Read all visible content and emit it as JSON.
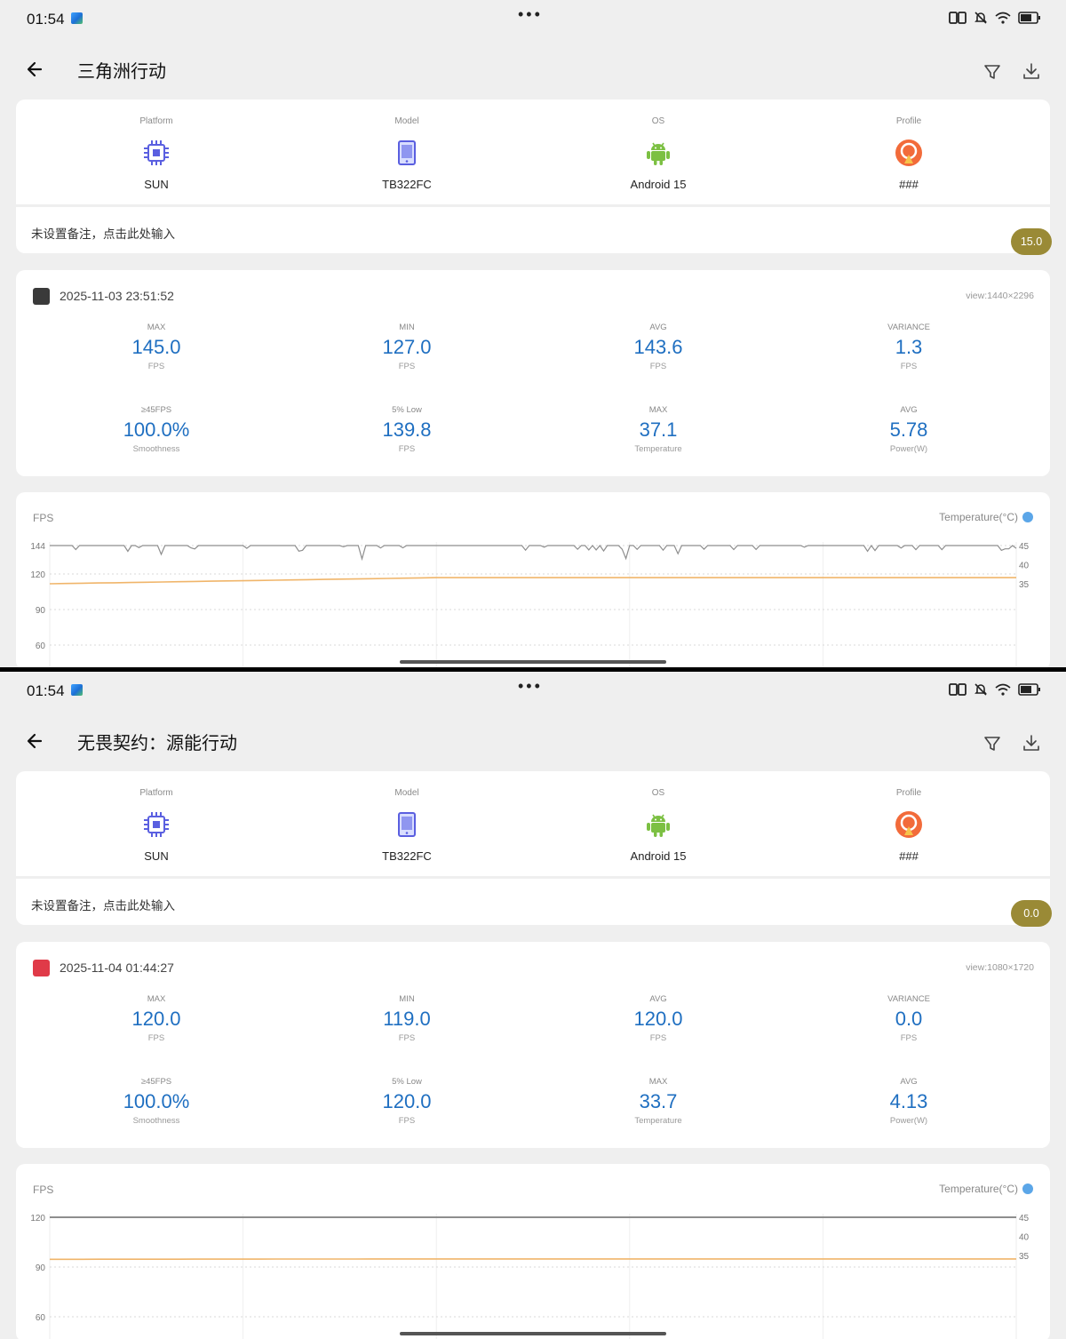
{
  "screens": [
    {
      "status": {
        "time": "01:54"
      },
      "header": {
        "title": "三角洲行动"
      },
      "device": [
        {
          "label": "Platform",
          "value": "SUN",
          "icon": "chip-icon"
        },
        {
          "label": "Model",
          "value": "TB322FC",
          "icon": "tablet-icon"
        },
        {
          "label": "OS",
          "value": "Android 15",
          "icon": "android-icon"
        },
        {
          "label": "Profile",
          "value": "###",
          "icon": "profile-icon"
        }
      ],
      "note": {
        "text": "未设置备注，点击此处输入",
        "score": "15.0"
      },
      "session": {
        "datetime": "2025-11-03 23:51:52",
        "view": "view:1440×2296",
        "metrics": [
          {
            "label": "MAX",
            "value": "145.0",
            "unit": "FPS"
          },
          {
            "label": "MIN",
            "value": "127.0",
            "unit": "FPS"
          },
          {
            "label": "AVG",
            "value": "143.6",
            "unit": "FPS"
          },
          {
            "label": "VARIANCE",
            "value": "1.3",
            "unit": "FPS"
          },
          {
            "label": "≥45FPS",
            "value": "100.0%",
            "unit": "Smoothness"
          },
          {
            "label": "5% Low",
            "value": "139.8",
            "unit": "FPS"
          },
          {
            "label": "MAX",
            "value": "37.1",
            "unit": "Temperature"
          },
          {
            "label": "AVG",
            "value": "5.78",
            "unit": "Power(W)"
          }
        ]
      },
      "chart_data": {
        "type": "line",
        "title": "FPS",
        "y2label": "Temperature(°C)",
        "y_ticks": [
          "144",
          "120",
          "90",
          "60"
        ],
        "y2_ticks": [
          "45",
          "40",
          "35"
        ],
        "series": [
          {
            "name": "FPS",
            "color": "#8e8e8e",
            "baseline": 144,
            "trend": "steady with brief dips"
          },
          {
            "name": "Temperature(°C)",
            "color": "#f0b56a",
            "start": 35,
            "end": 36.6,
            "trend": "slowly rising"
          }
        ],
        "grid": true
      }
    },
    {
      "status": {
        "time": "01:54"
      },
      "header": {
        "title": "无畏契约：源能行动"
      },
      "device": [
        {
          "label": "Platform",
          "value": "SUN",
          "icon": "chip-icon"
        },
        {
          "label": "Model",
          "value": "TB322FC",
          "icon": "tablet-icon"
        },
        {
          "label": "OS",
          "value": "Android 15",
          "icon": "android-icon"
        },
        {
          "label": "Profile",
          "value": "###",
          "icon": "profile-icon"
        }
      ],
      "note": {
        "text": "未设置备注，点击此处输入",
        "score": "0.0"
      },
      "session": {
        "datetime": "2025-11-04 01:44:27",
        "view": "view:1080×1720",
        "metrics": [
          {
            "label": "MAX",
            "value": "120.0",
            "unit": "FPS"
          },
          {
            "label": "MIN",
            "value": "119.0",
            "unit": "FPS"
          },
          {
            "label": "AVG",
            "value": "120.0",
            "unit": "FPS"
          },
          {
            "label": "VARIANCE",
            "value": "0.0",
            "unit": "FPS"
          },
          {
            "label": "≥45FPS",
            "value": "100.0%",
            "unit": "Smoothness"
          },
          {
            "label": "5% Low",
            "value": "120.0",
            "unit": "FPS"
          },
          {
            "label": "MAX",
            "value": "33.7",
            "unit": "Temperature"
          },
          {
            "label": "AVG",
            "value": "4.13",
            "unit": "Power(W)"
          }
        ]
      },
      "chart_data": {
        "type": "line",
        "title": "FPS",
        "y2label": "Temperature(°C)",
        "y_ticks": [
          "120",
          "90",
          "60"
        ],
        "y2_ticks": [
          "45",
          "40",
          "35"
        ],
        "series": [
          {
            "name": "FPS",
            "color": "#8e8e8e",
            "baseline": 120,
            "trend": "flat"
          },
          {
            "name": "Temperature(°C)",
            "color": "#f0b56a",
            "start": 34,
            "end": 34.1,
            "trend": "flat"
          }
        ],
        "grid": true
      }
    }
  ]
}
